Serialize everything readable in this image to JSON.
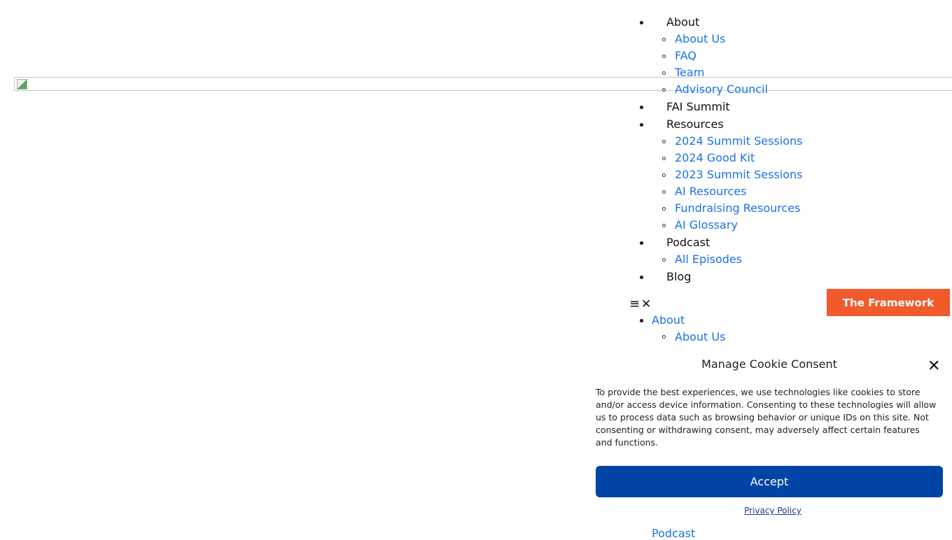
{
  "menu": [
    {
      "label": "About",
      "children": [
        "About Us",
        "FAQ",
        "Team",
        "Advisory Council"
      ]
    },
    {
      "label": "FAI Summit",
      "children": []
    },
    {
      "label": "Resources",
      "children": [
        "2024 Summit Sessions",
        "2024 Good Kit",
        "2023 Summit Sessions",
        "AI Resources",
        "Fundraising Resources",
        "AI Glossary"
      ]
    },
    {
      "label": "Podcast",
      "children": [
        "All Episodes"
      ]
    },
    {
      "label": "Blog",
      "children": []
    }
  ],
  "mobile_toggle": {
    "icons": [
      "menu-icon",
      "close-icon"
    ],
    "open": "≡",
    "close": "✕"
  },
  "cta_button": "The Framework",
  "mobile_menu": {
    "about": "About",
    "about_us": "About Us",
    "podcast": "Podcast"
  },
  "cookie": {
    "title": "Manage Cookie Consent",
    "text": "To provide the best experiences, we use technologies like cookies to store and/or access device information. Consenting to these technologies will allow us to process data such as browsing behavior or unique IDs on this site. Not consenting or withdrawing consent, may adversely affect certain features and functions.",
    "accept": "Accept",
    "privacy": "Privacy Policy",
    "close": "✕"
  },
  "colors": {
    "link": "#1a73e8",
    "cta": "#f15a2b",
    "accept": "#0044a6"
  }
}
